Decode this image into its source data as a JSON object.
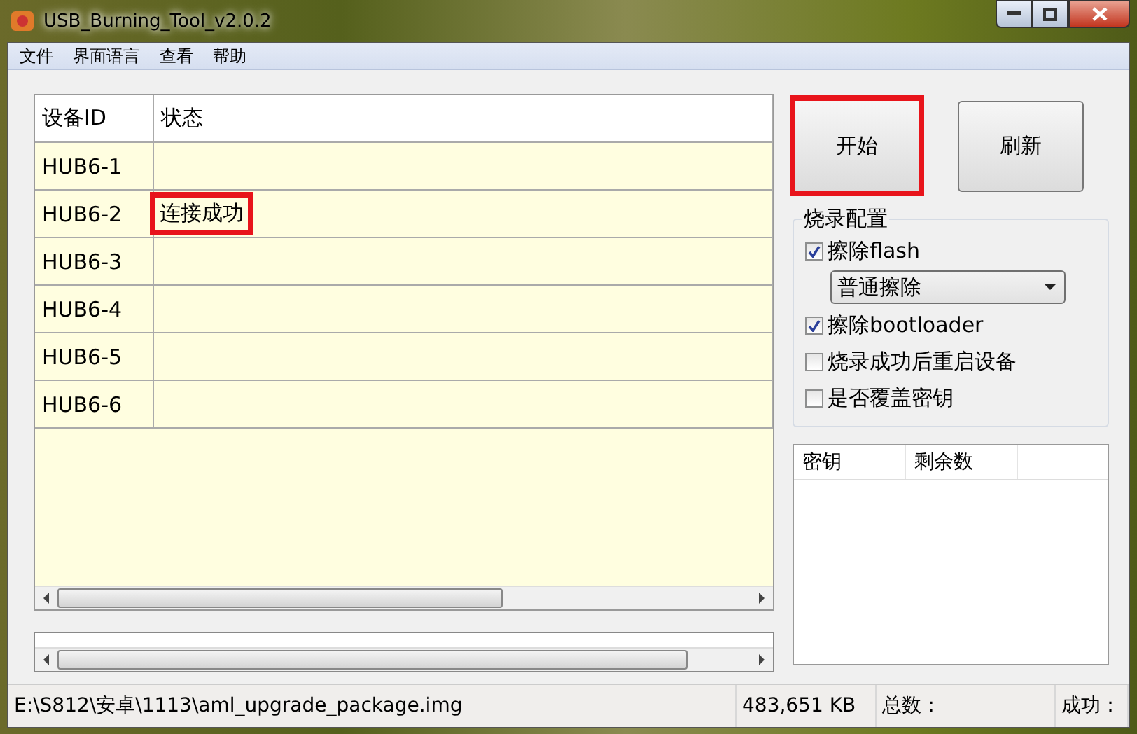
{
  "window": {
    "title": "USB_Burning_Tool_v2.0.2"
  },
  "menu": [
    "文件",
    "界面语言",
    "查看",
    "帮助"
  ],
  "device_table": {
    "columns": [
      "设备ID",
      "状态"
    ],
    "rows": [
      {
        "id": "HUB6-1",
        "status": "",
        "highlighted": false
      },
      {
        "id": "HUB6-2",
        "status": "连接成功",
        "highlighted": true
      },
      {
        "id": "HUB6-3",
        "status": "",
        "highlighted": false
      },
      {
        "id": "HUB6-4",
        "status": "",
        "highlighted": false
      },
      {
        "id": "HUB6-5",
        "status": "",
        "highlighted": false
      },
      {
        "id": "HUB6-6",
        "status": "",
        "highlighted": false
      }
    ]
  },
  "buttons": [
    {
      "label": "开始",
      "highlighted": true
    },
    {
      "label": "刷新",
      "highlighted": false
    }
  ],
  "burn_config": {
    "title": "烧录配置",
    "options": [
      {
        "kind": "checkbox",
        "label": "擦除flash",
        "checked": true
      },
      {
        "kind": "select",
        "value": "普通擦除"
      },
      {
        "kind": "checkbox",
        "label": "擦除bootloader",
        "checked": true
      },
      {
        "kind": "checkbox",
        "label": "烧录成功后重启设备",
        "checked": false
      },
      {
        "kind": "checkbox",
        "label": "是否覆盖密钥",
        "checked": false
      }
    ]
  },
  "key_table": {
    "columns": [
      "密钥",
      "剩余数"
    ]
  },
  "status_bar": [
    "E:\\S812\\安卓\\1113\\aml_upgrade_package.img",
    "483,651 KB",
    "总数：",
    "成功："
  ]
}
